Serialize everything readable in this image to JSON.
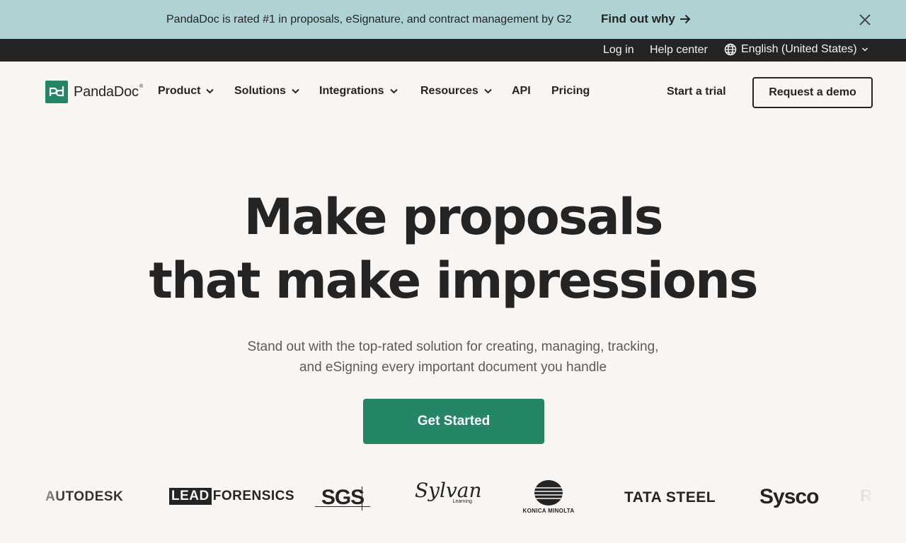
{
  "banner": {
    "text": "PandaDoc is rated #1 in proposals, eSignature, and contract management by G2",
    "link_label": "Find out why",
    "icons": [
      "arrow-right-icon",
      "close-icon"
    ]
  },
  "utility": {
    "login": "Log in",
    "help": "Help center",
    "language": "English (United States)",
    "icons": [
      "globe-icon",
      "chevron-down-icon"
    ]
  },
  "nav": {
    "logo_text": "PandaDoc",
    "logo_mark": "pd",
    "logo_reg": "®",
    "items": [
      {
        "label": "Product",
        "dropdown": true
      },
      {
        "label": "Solutions",
        "dropdown": true
      },
      {
        "label": "Integrations",
        "dropdown": true
      },
      {
        "label": "Resources",
        "dropdown": true
      },
      {
        "label": "API",
        "dropdown": false
      },
      {
        "label": "Pricing",
        "dropdown": false
      }
    ],
    "start_trial": "Start a trial",
    "request_demo": "Request a demo"
  },
  "hero": {
    "title_line1": "Make proposals",
    "title_line2": "that make impressions",
    "subtitle": "Stand out with the top-rated solution for creating, managing, tracking, and eSigning every important document you handle",
    "cta": "Get Started"
  },
  "clients": {
    "autodesk": "AUTODESK",
    "lead": "LEAD",
    "forensics": "FORENSICS",
    "sgs": "SGS",
    "sylvan": "Sylvan",
    "sylvan_sub": "Learning",
    "konica": "KONICA MINOLTA",
    "tata": "TATA STEEL",
    "sysco": "Sysco",
    "partial": "R"
  },
  "colors": {
    "banner_bg": "#afd2d5",
    "utility_bg": "#242424",
    "page_bg": "#f8f5f3",
    "brand_green": "#248567",
    "text": "#242424"
  }
}
